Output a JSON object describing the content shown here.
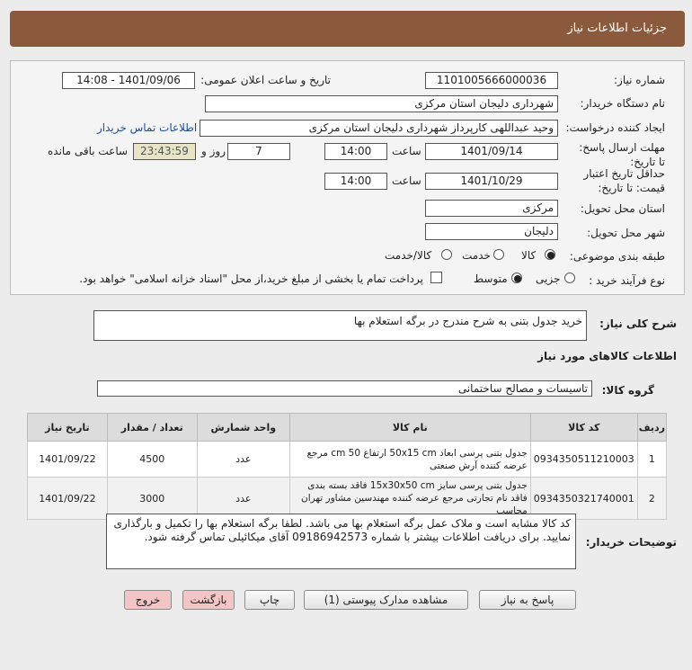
{
  "window": {
    "title": "جزئیات اطلاعات نیاز"
  },
  "form": {
    "need_number_label": "شماره نیاز:",
    "need_number": "1101005666000036",
    "announce_label": "تاریخ و ساعت اعلان عمومی:",
    "announce_value": "1401/09/06 - 14:08",
    "buyer_org_label": "نام دستگاه خریدار:",
    "buyer_org": "شهرداری دلیجان استان مرکزی",
    "requester_label": "ایجاد کننده درخواست:",
    "requester": "وحید عبداللهی کارپرداز شهرداری دلیجان استان مرکزی",
    "contact_link": "اطلاعات تماس خریدار",
    "deadline_label": "مهلت ارسال پاسخ: تا تاریخ:",
    "deadline_date": "1401/09/14",
    "time_label": "ساعت",
    "deadline_time": "14:00",
    "days_value": "7",
    "days_label": "روز و",
    "remaining_time": "23:43:59",
    "remaining_label": "ساعت باقی مانده",
    "validity_label": "حداقل تاریخ اعتبار قیمت: تا تاریخ:",
    "validity_date": "1401/10/29",
    "validity_time": "14:00",
    "province_label": "استان محل تحویل:",
    "province": "مرکزی",
    "city_label": "شهر محل تحویل:",
    "city": "دلیجان",
    "category_label": "طبقه بندی موضوعی:",
    "category_options": [
      "کالا",
      "خدمت",
      "کالا/خدمت"
    ],
    "process_label": "نوع فرآیند خرید :",
    "process_options": [
      "جزیی",
      "متوسط"
    ],
    "payment_note": "پرداخت تمام یا بخشی از مبلغ خرید،از محل \"اسناد خزانه اسلامی\" خواهد بود."
  },
  "summary": {
    "label": "شرح کلی نیاز:",
    "value": "خرید جدول بتنی به شرح مندرج در برگه استعلام بها"
  },
  "goods_info": {
    "title": "اطلاعات کالاهای مورد نیاز"
  },
  "goods_group": {
    "label": "گروه کالا:",
    "value": "تاسیسات و مصالح ساختمانی"
  },
  "table": {
    "headers": [
      "ردیف",
      "کد کالا",
      "نام کالا",
      "واحد شمارش",
      "تعداد / مقدار",
      "تاریخ نیاز"
    ],
    "rows": [
      {
        "index": "1",
        "code": "0934350511210003",
        "name": "جدول بتنی پرسی ابعاد 50x15 cm ارتفاع 50 cm مرجع عرضه کننده آرش صنعتی",
        "unit": "عدد",
        "qty": "4500",
        "date": "1401/09/22"
      },
      {
        "index": "2",
        "code": "0934350321740001",
        "name": "جدول بتنی پرسی سایز 15x30x50 cm فاقد بسته بندی فاقد نام تجارتی مرجع عرضه کننده مهندسین مشاور تهران محاسب",
        "unit": "عدد",
        "qty": "3000",
        "date": "1401/09/22"
      }
    ]
  },
  "buyer_notes": {
    "label": "توضیحات خریدار:",
    "value": "کد کالا مشابه است و ملاک عمل برگه استعلام بها می باشد. لطفا برگه استعلام بها را تکمیل و بارگذاری نمایید. برای دریافت اطلاعات بیشتر با شماره 09186942573 آقای میکائیلی تماس گرفته شود."
  },
  "buttons": {
    "reply": "پاسخ به نیاز",
    "attachments": "مشاهده مدارک پیوستی (1)",
    "print": "چاپ",
    "back": "بازگشت",
    "exit": "خروج"
  },
  "colors": {
    "title_bar": "#8b5a3c",
    "link": "#1a4fa0",
    "highlight": "#e8e4c8",
    "exit_button": "#f3c6c6"
  }
}
